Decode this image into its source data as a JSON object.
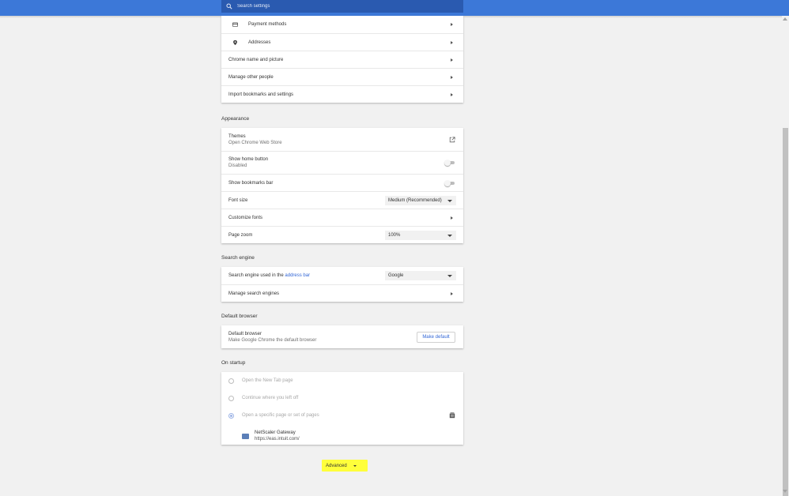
{
  "search": {
    "placeholder": "Search settings"
  },
  "people": {
    "items": [
      {
        "label": "Payment methods",
        "icon": "credit-card-icon"
      },
      {
        "label": "Addresses",
        "icon": "location-pin-icon"
      },
      {
        "label": "Chrome name and picture"
      },
      {
        "label": "Manage other people"
      },
      {
        "label": "Import bookmarks and settings"
      }
    ]
  },
  "appearance": {
    "title": "Appearance",
    "themes_label": "Themes",
    "themes_sub": "Open Chrome Web Store",
    "home_label": "Show home button",
    "home_sub": "Disabled",
    "bookmarks_label": "Show bookmarks bar",
    "font_size_label": "Font size",
    "font_size_value": "Medium (Recommended)",
    "customize_fonts_label": "Customize fonts",
    "page_zoom_label": "Page zoom",
    "page_zoom_value": "100%"
  },
  "search_engine": {
    "title": "Search engine",
    "used_label": "Search engine used in the ",
    "used_link": "address bar",
    "value": "Google",
    "manage_label": "Manage search engines"
  },
  "default_browser": {
    "title": "Default browser",
    "label": "Default browser",
    "sub": "Make Google Chrome the default browser",
    "button": "Make default"
  },
  "startup": {
    "title": "On startup",
    "options": [
      "Open the New Tab page",
      "Continue where you left off",
      "Open a specific page or set of pages"
    ],
    "site_name": "NetScaler Gateway",
    "site_url": "https://eas.intuit.com/"
  },
  "advanced": {
    "label": "Advanced"
  },
  "colors": {
    "topbar": "#3c78d8",
    "search_box": "#2a5ab0",
    "link": "#3367d6",
    "highlight": "#ffff3b"
  }
}
